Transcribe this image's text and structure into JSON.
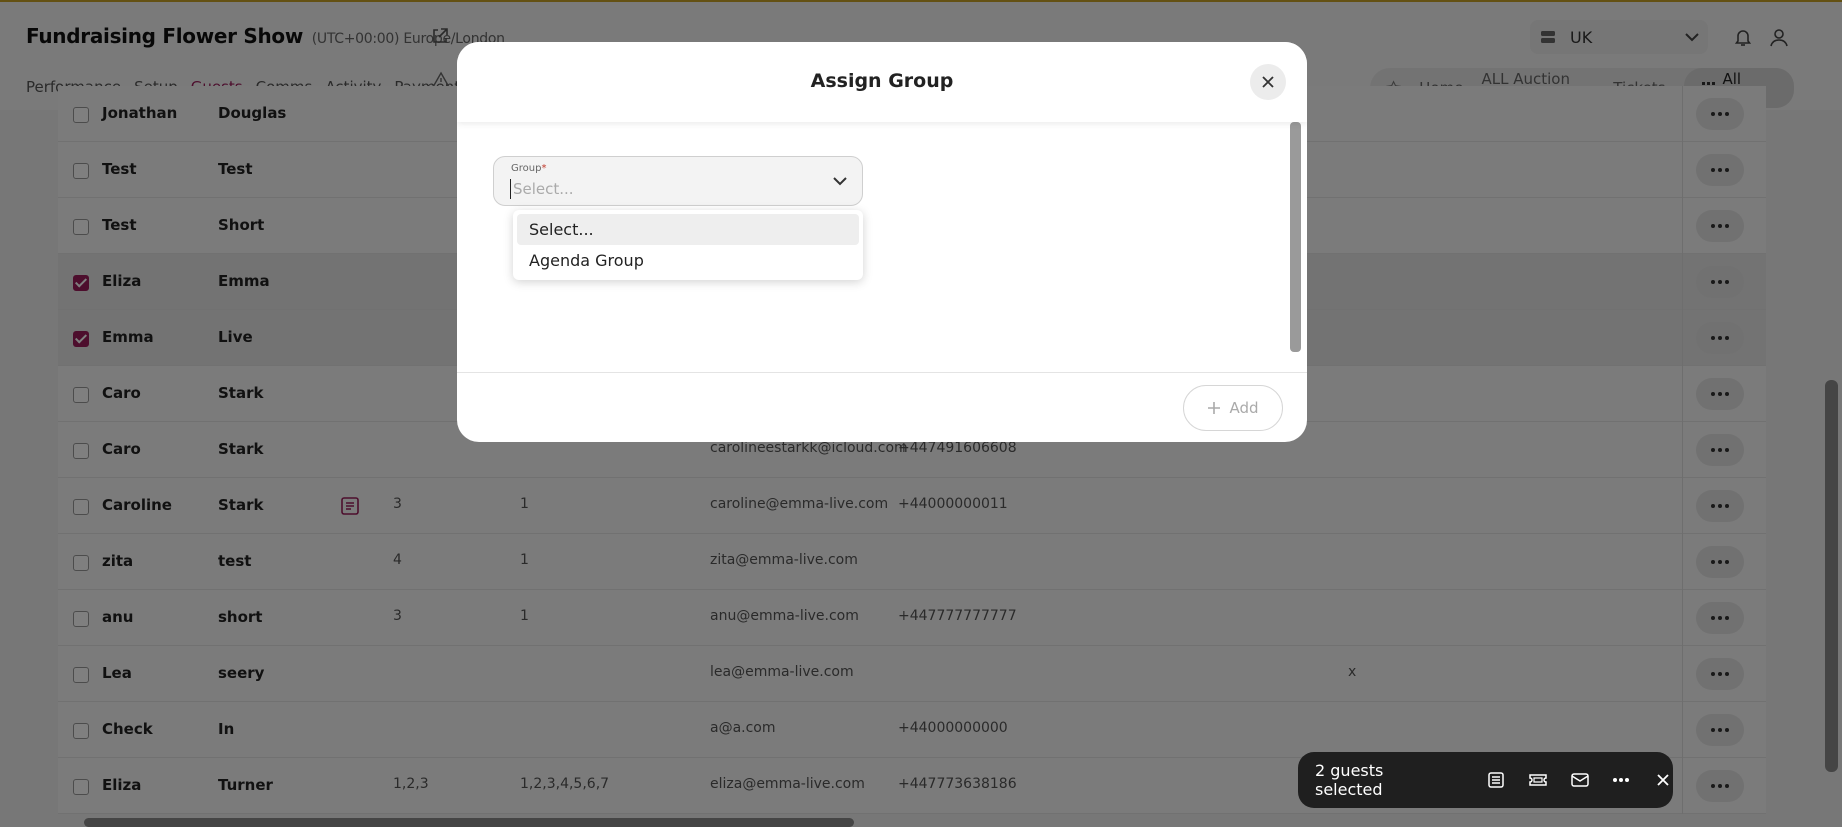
{
  "header": {
    "title": "Fundraising Flower Show",
    "timezone": "(UTC+00:00) Europe/London",
    "nav": [
      {
        "label": "Performance"
      },
      {
        "label": "Setup"
      },
      {
        "label": "Guests",
        "active": true
      },
      {
        "label": "Comms"
      },
      {
        "label": "Activity"
      },
      {
        "label": "Payments"
      }
    ],
    "region": "UK",
    "quick_links": [
      "Home",
      "ALL Auction Items",
      "Tickets"
    ],
    "all_pages_label": "All Pages"
  },
  "table": {
    "rows": [
      {
        "first": "Jonathan",
        "last": "Douglas",
        "selected": false
      },
      {
        "first": "Test",
        "last": "Test",
        "selected": false
      },
      {
        "first": "Test",
        "last": "Short",
        "selected": false
      },
      {
        "first": "Eliza",
        "last": "Emma",
        "selected": true
      },
      {
        "first": "Emma",
        "last": "Live",
        "selected": true
      },
      {
        "first": "Caro",
        "last": "Stark",
        "selected": false
      },
      {
        "first": "Caro",
        "last": "Stark",
        "selected": false,
        "email": "carolineestarkk@icloud.com",
        "phone": "+447491606608"
      },
      {
        "first": "Caroline",
        "last": "Stark",
        "selected": false,
        "has_note": true,
        "c1": "3",
        "c2": "1",
        "email": "caroline@emma-live.com",
        "phone": "+44000000011"
      },
      {
        "first": "zita",
        "last": "test",
        "selected": false,
        "c1": "4",
        "c2": "1",
        "email": "zita@emma-live.com"
      },
      {
        "first": "anu",
        "last": "short",
        "selected": false,
        "c1": "3",
        "c2": "1",
        "email": "anu@emma-live.com",
        "phone": "+447777777777"
      },
      {
        "first": "Lea",
        "last": "seery",
        "selected": false,
        "email": "lea@emma-live.com",
        "extra": "x"
      },
      {
        "first": "Check",
        "last": "In",
        "selected": false,
        "email": "a@a.com",
        "phone": "+44000000000"
      },
      {
        "first": "Eliza",
        "last": "Turner",
        "selected": false,
        "c1": "1,2,3",
        "c2": "1,2,3,4,5,6,7",
        "email": "eliza@emma-live.com",
        "phone": "+447773638186"
      }
    ]
  },
  "modal": {
    "title": "Assign Group",
    "field_label": "Group",
    "required_mark": "*",
    "placeholder": "Select...",
    "options": [
      "Select...",
      "Agenda Group"
    ],
    "add_label": "Add"
  },
  "selection_bar": {
    "label": "2 guests selected"
  },
  "colors": {
    "accent": "#9b1d5b",
    "selection_bar": "#1f1f1f"
  }
}
